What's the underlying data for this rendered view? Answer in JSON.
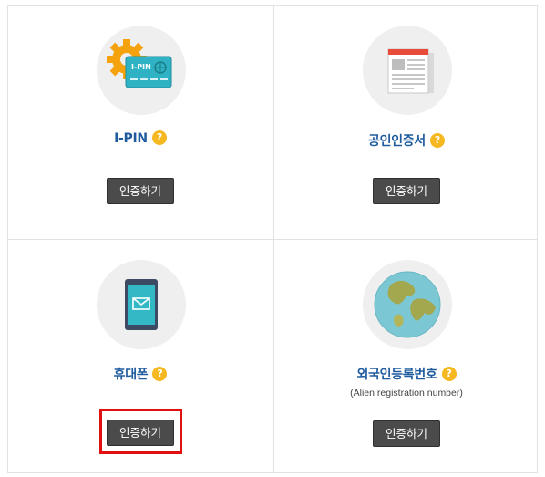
{
  "colors": {
    "label": "#1f5c9e",
    "button_bg": "#4b4b4b",
    "help_icon": "#f5b820",
    "highlight": "#e01010"
  },
  "options": [
    {
      "icon": "ipin-card-gear-icon",
      "card_text": "I-PIN",
      "label": "I-PIN",
      "help": "?",
      "button": "인증하기"
    },
    {
      "icon": "certificate-document-icon",
      "label": "공인인증서",
      "help": "?",
      "button": "인증하기"
    },
    {
      "icon": "mobile-phone-mail-icon",
      "label": "휴대폰",
      "help": "?",
      "button": "인증하기",
      "highlighted": true
    },
    {
      "icon": "globe-icon",
      "label": "외국인등록번호",
      "sublabel": "(Alien registration number)",
      "help": "?",
      "button": "인증하기"
    }
  ]
}
